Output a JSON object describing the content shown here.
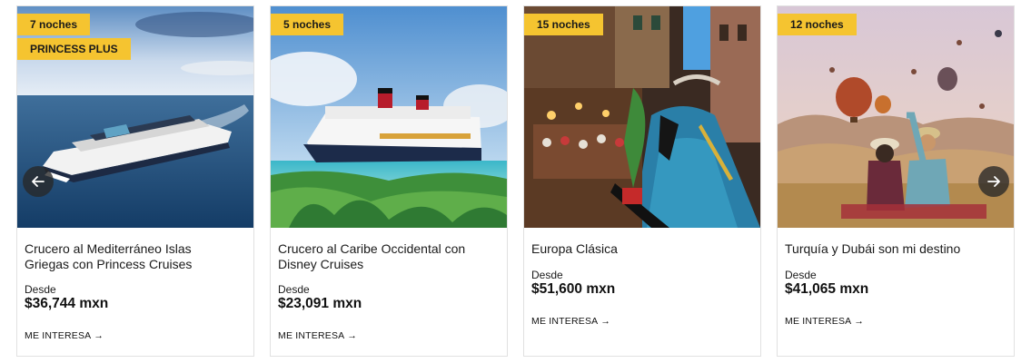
{
  "cards": [
    {
      "nights": "7 noches",
      "tag": "PRINCESS PLUS",
      "title": "Crucero al Mediterráneo Islas Griegas con Princess Cruises",
      "from_label": "Desde",
      "price": "$36,744 mxn",
      "cta": "ME INTERESA"
    },
    {
      "nights": "5 noches",
      "title": "Crucero al Caribe Occidental con Disney Cruises",
      "from_label": "Desde",
      "price": "$23,091 mxn",
      "cta": "ME INTERESA"
    },
    {
      "nights": "15 noches",
      "title": "Europa Clásica",
      "from_label": "Desde",
      "price": "$51,600 mxn",
      "cta": "ME INTERESA"
    },
    {
      "nights": "12 noches",
      "title": "Turquía y Dubái son mi destino",
      "from_label": "Desde",
      "price": "$41,065 mxn",
      "cta": "ME INTERESA"
    }
  ],
  "navigation": {
    "prev_icon": "arrow-left-icon",
    "next_icon": "arrow-right-icon"
  },
  "colors": {
    "badge": "#f5c430",
    "nav_button": "#282828"
  }
}
